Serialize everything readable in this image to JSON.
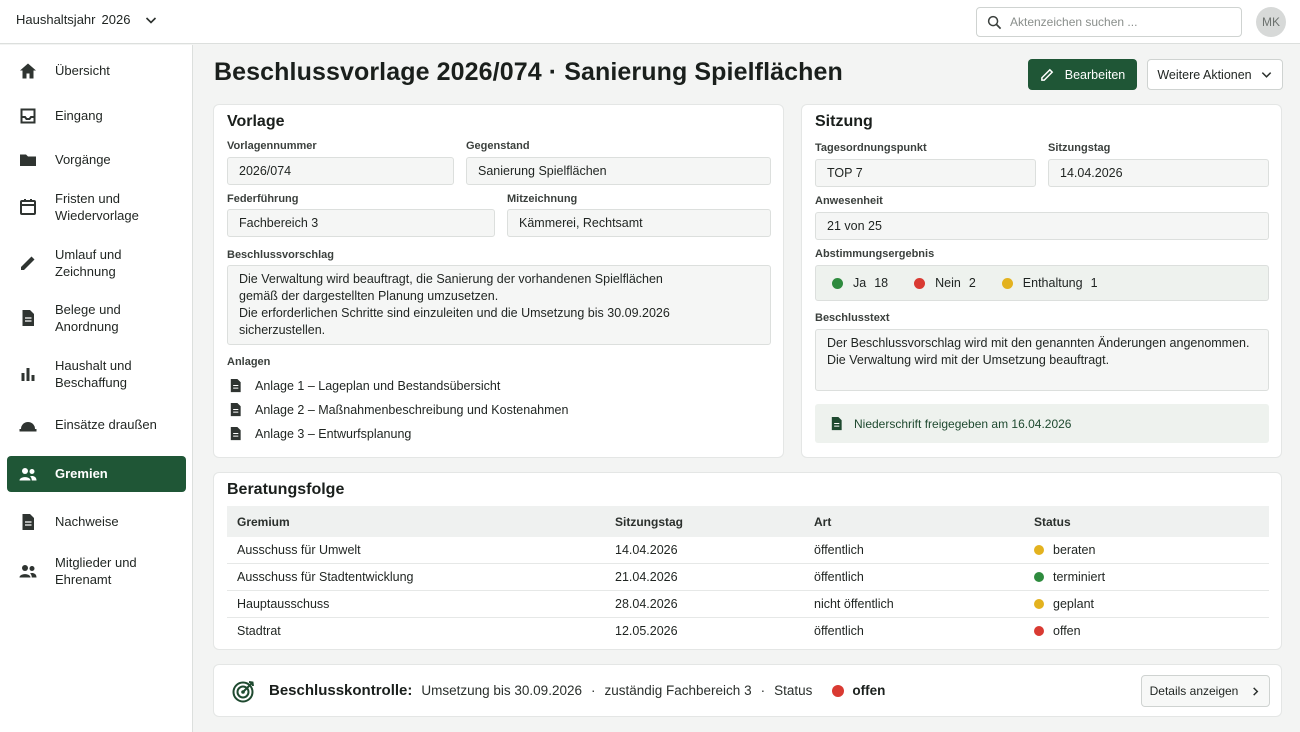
{
  "header": {
    "year_label": "Haushaltsjahr",
    "year_value": "2026",
    "search_placeholder": "Aktenzeichen suchen ...",
    "avatar_initials": "MK"
  },
  "sidebar": {
    "items": [
      {
        "label": "Übersicht",
        "icon": "home-icon"
      },
      {
        "label": "Eingang",
        "icon": "inbox-icon"
      },
      {
        "label": "Vorgänge",
        "icon": "folder-icon"
      },
      {
        "label": "Fristen und\nWiedervorlage",
        "icon": "calendar-icon"
      },
      {
        "label": "Umlauf und\nZeichnung",
        "icon": "pencil-icon"
      },
      {
        "label": "Belege und\nAnordnung",
        "icon": "document-icon"
      },
      {
        "label": "Haushalt und\nBeschaffung",
        "icon": "bar-chart-icon"
      },
      {
        "label": "Einsätze draußen",
        "icon": "hard-hat-icon"
      },
      {
        "label": "Gremien",
        "icon": "people-icon",
        "active": true
      },
      {
        "label": "Nachweise",
        "icon": "document-icon"
      },
      {
        "label": "Mitglieder und\nEhrenamt",
        "icon": "people-icon"
      }
    ]
  },
  "page": {
    "title": "Beschlussvorlage 2026/074 · Sanierung Spielflächen",
    "edit_label": "Bearbeiten",
    "more_label": "Weitere Aktionen"
  },
  "vorlage": {
    "title": "Vorlage",
    "number_label": "Vorlagennummer",
    "number_value": "2026/074",
    "subject_label": "Gegenstand",
    "subject_value": "Sanierung Spielflächen",
    "lead_label": "Federführung",
    "lead_value": "Fachbereich 3",
    "cosign_label": "Mitzeichnung",
    "cosign_value": "Kämmerei, Rechtsamt",
    "proposal_label": "Beschlussvorschlag",
    "proposal_text": "Die Verwaltung wird beauftragt, die Sanierung der vorhandenen Spielflächen\ngemäß der dargestellten Planung umzusetzen.\nDie erforderlichen Schritte sind einzuleiten und die Umsetzung bis 30.09.2026\nsicherzustellen.",
    "attachments_label": "Anlagen",
    "attachments": [
      "Anlage 1 – Lageplan und Bestandsübersicht",
      "Anlage 2 – Maßnahmenbeschreibung und Kostenahmen",
      "Anlage 3 – Entwurfsplanung"
    ]
  },
  "sitzung": {
    "title": "Sitzung",
    "agenda_label": "Tagesordnungspunkt",
    "agenda_value": "TOP 7",
    "date_label": "Sitzungstag",
    "date_value": "14.04.2026",
    "attendance_label": "Anwesenheit",
    "attendance_value": "21 von 25",
    "vote_label": "Abstimmungsergebnis",
    "votes": [
      {
        "label": "Ja",
        "count": "18",
        "color": "#2e8b3e"
      },
      {
        "label": "Nein",
        "count": "2",
        "color": "#d93a32"
      },
      {
        "label": "Enthaltung",
        "count": "1",
        "color": "#e3b21f"
      }
    ],
    "resolution_label": "Beschlusstext",
    "resolution_text": "Der Beschlussvorschlag wird mit den genannten Änderungen angenommen.\nDie Verwaltung wird mit der Umsetzung beauftragt.",
    "minutes_text": "Niederschrift freigegeben am 16.04.2026"
  },
  "beratungsfolge": {
    "title": "Beratungsfolge",
    "columns": [
      "Gremium",
      "Sitzungstag",
      "Art",
      "Status"
    ],
    "rows": [
      {
        "gremium": "Ausschuss für Umwelt",
        "date": "14.04.2026",
        "art": "öffentlich",
        "status": "beraten",
        "color": "#e3b21f"
      },
      {
        "gremium": "Ausschuss für Stadtentwicklung",
        "date": "21.04.2026",
        "art": "öffentlich",
        "status": "terminiert",
        "color": "#2e8b3e"
      },
      {
        "gremium": "Hauptausschuss",
        "date": "28.04.2026",
        "art": "nicht öffentlich",
        "status": "geplant",
        "color": "#e3b21f"
      },
      {
        "gremium": "Stadtrat",
        "date": "12.05.2026",
        "art": "öffentlich",
        "status": "offen",
        "color": "#d93a32"
      }
    ]
  },
  "kontrolle": {
    "label": "Beschlusskontrolle:",
    "deadline": "Umsetzung bis 30.09.2026",
    "responsible": "zuständig Fachbereich 3",
    "status_label": "Status",
    "status_value": "offen",
    "status_color": "#d93a32",
    "details_label": "Details anzeigen"
  },
  "colors": {
    "accent": "#1f5636"
  }
}
